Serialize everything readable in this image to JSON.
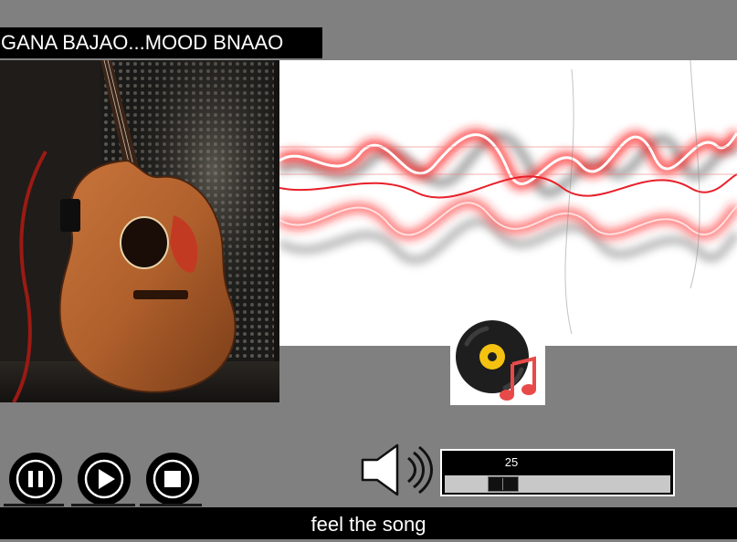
{
  "header": {
    "title": "GANA BAJAO...MOOD BNAAO"
  },
  "images": {
    "guitar": "acoustic-guitar-photo",
    "waveform": "red-sound-wave-graphic",
    "disc": "vinyl-record-music-note-icon"
  },
  "controls": {
    "pause": "pause-icon",
    "play": "play-icon",
    "stop": "stop-icon"
  },
  "volume": {
    "icon": "speaker-icon",
    "value": "25",
    "level_fraction": 0.25
  },
  "footer": {
    "text": "feel the song"
  },
  "colors": {
    "background": "#808080",
    "bar": "#000000",
    "accent_red": "#e8202a",
    "disc_yellow": "#f5c211"
  }
}
